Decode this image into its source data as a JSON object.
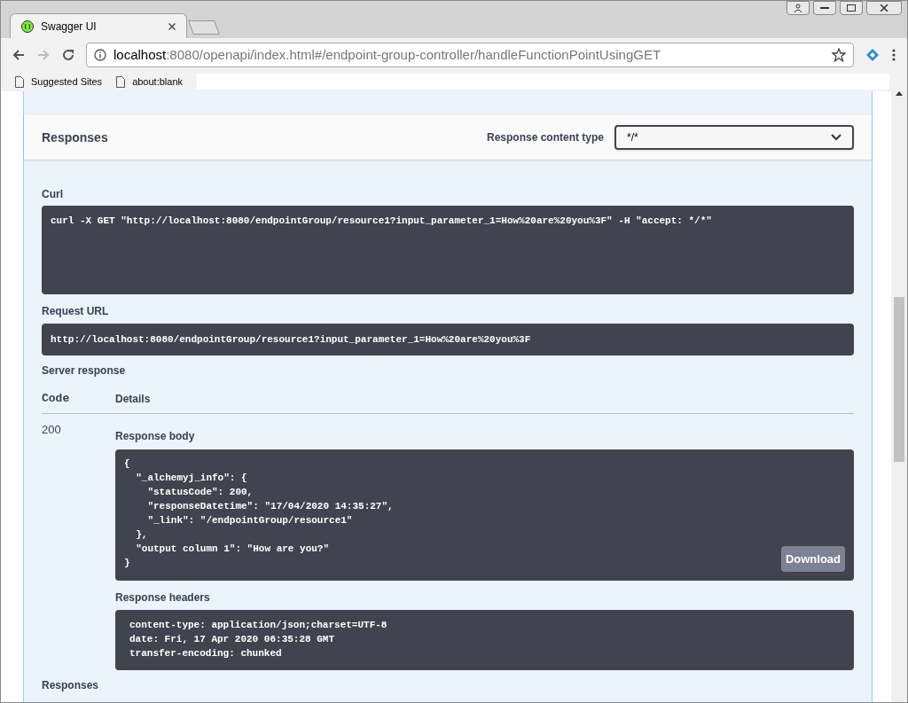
{
  "browser": {
    "tab_title": "Swagger UI",
    "url_host": "localhost",
    "url_path": ":8080/openapi/index.html#/endpoint-group-controller/handleFunctionPointUsingGET",
    "bookmarks": [
      "Suggested Sites",
      "about:blank"
    ]
  },
  "responses_header": {
    "title": "Responses",
    "content_type_label": "Response content type",
    "content_type_value": "*/*"
  },
  "curl": {
    "label": "Curl",
    "command": "curl -X GET \"http://localhost:8080/endpointGroup/resource1?input_parameter_1=How%20are%20you%3F\" -H \"accept: */*\""
  },
  "request_url": {
    "label": "Request URL",
    "value": "http://localhost:8080/endpointGroup/resource1?input_parameter_1=How%20are%20you%3F"
  },
  "server_response": {
    "label": "Server response",
    "columns": [
      "Code",
      "Details"
    ],
    "code": "200",
    "body_label": "Response body",
    "body_lines": [
      "{",
      "  \"_alchemyj_info\": {",
      "    \"statusCode\": 200,",
      "    \"responseDatetime\": \"17/04/2020 14:35:27\",",
      "    \"_link\": \"/endpointGroup/resource1\"",
      "  },",
      "  \"output column 1\": \"How are you?\"",
      "}"
    ],
    "download_button": "Download",
    "headers_label": "Response headers",
    "header_lines": [
      "content-type: application/json;charset=UTF-8",
      "date: Fri, 17 Apr 2020 06:35:28 GMT",
      "transfer-encoding: chunked"
    ]
  },
  "footer_label": "Responses"
}
